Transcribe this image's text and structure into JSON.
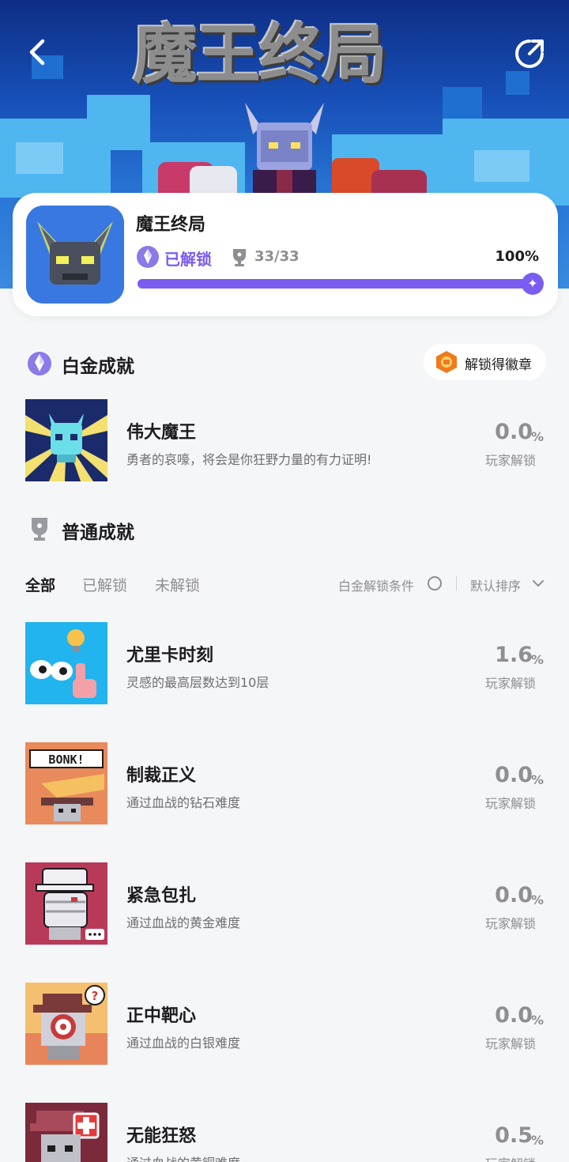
{
  "header": {
    "banner_title": "魔王终局",
    "back_icon": "chevron-left-icon",
    "share_icon": "share-icon"
  },
  "game": {
    "name": "魔王终局",
    "status_label": "已解锁",
    "trophy_count": "33/33",
    "progress_label": "100%",
    "progress": 1.0,
    "accent_color": "#7b5cf0"
  },
  "platinum": {
    "title": "白金成就",
    "badge_button": "解锁得徽章",
    "item": {
      "name": "伟大魔王",
      "desc": "勇者的哀嚎，将会是你狂野力量的有力证明!",
      "rate": "0.0",
      "unit": "%",
      "sub": "玩家解锁"
    }
  },
  "normal": {
    "title": "普通成就",
    "tabs": [
      "全部",
      "已解锁",
      "未解锁"
    ],
    "condition_label": "白金解锁条件",
    "sort_label": "默认排序",
    "items": [
      {
        "name": "尤里卡时刻",
        "desc": "灵感的最高层数达到10层",
        "rate": "1.6",
        "unit": "%",
        "sub": "玩家解锁"
      },
      {
        "name": "制裁正义",
        "desc": "通过血战的钻石难度",
        "rate": "0.0",
        "unit": "%",
        "sub": "玩家解锁"
      },
      {
        "name": "紧急包扎",
        "desc": "通过血战的黄金难度",
        "rate": "0.0",
        "unit": "%",
        "sub": "玩家解锁"
      },
      {
        "name": "正中靶心",
        "desc": "通过血战的白银难度",
        "rate": "0.0",
        "unit": "%",
        "sub": "玩家解锁"
      },
      {
        "name": "无能狂怒",
        "desc": "通过血战的黄铜难度",
        "rate": "0.5",
        "unit": "%",
        "sub": "玩家解锁"
      }
    ]
  }
}
